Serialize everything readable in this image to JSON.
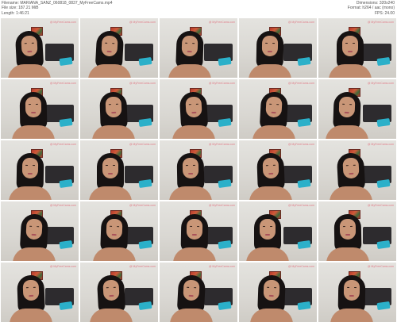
{
  "header": {
    "left": [
      {
        "key": "Filename:",
        "value": "MARIANA_SANZ_060818_0837_MyFreeCams.mp4"
      },
      {
        "key": "File size:",
        "value": "187.21 MiB"
      },
      {
        "key": "Length:",
        "value": "1:46:21"
      }
    ],
    "right": [
      {
        "key": "Dimensions:",
        "value": "320x240"
      },
      {
        "key": "Format:",
        "value": "h264 / aac (mono)"
      },
      {
        "key": "FPS:",
        "value": "24.00"
      }
    ]
  },
  "thumbnails": {
    "rows": 5,
    "columns": 5,
    "watermark": "@ MyFreeCams.com",
    "colors": {
      "wall": "#dcdad6",
      "headboard": "#2d2b2e",
      "pillow": "#2bb0c9",
      "hair": "#161212",
      "skin": "#c99677",
      "watermark": "#e07a86"
    }
  }
}
